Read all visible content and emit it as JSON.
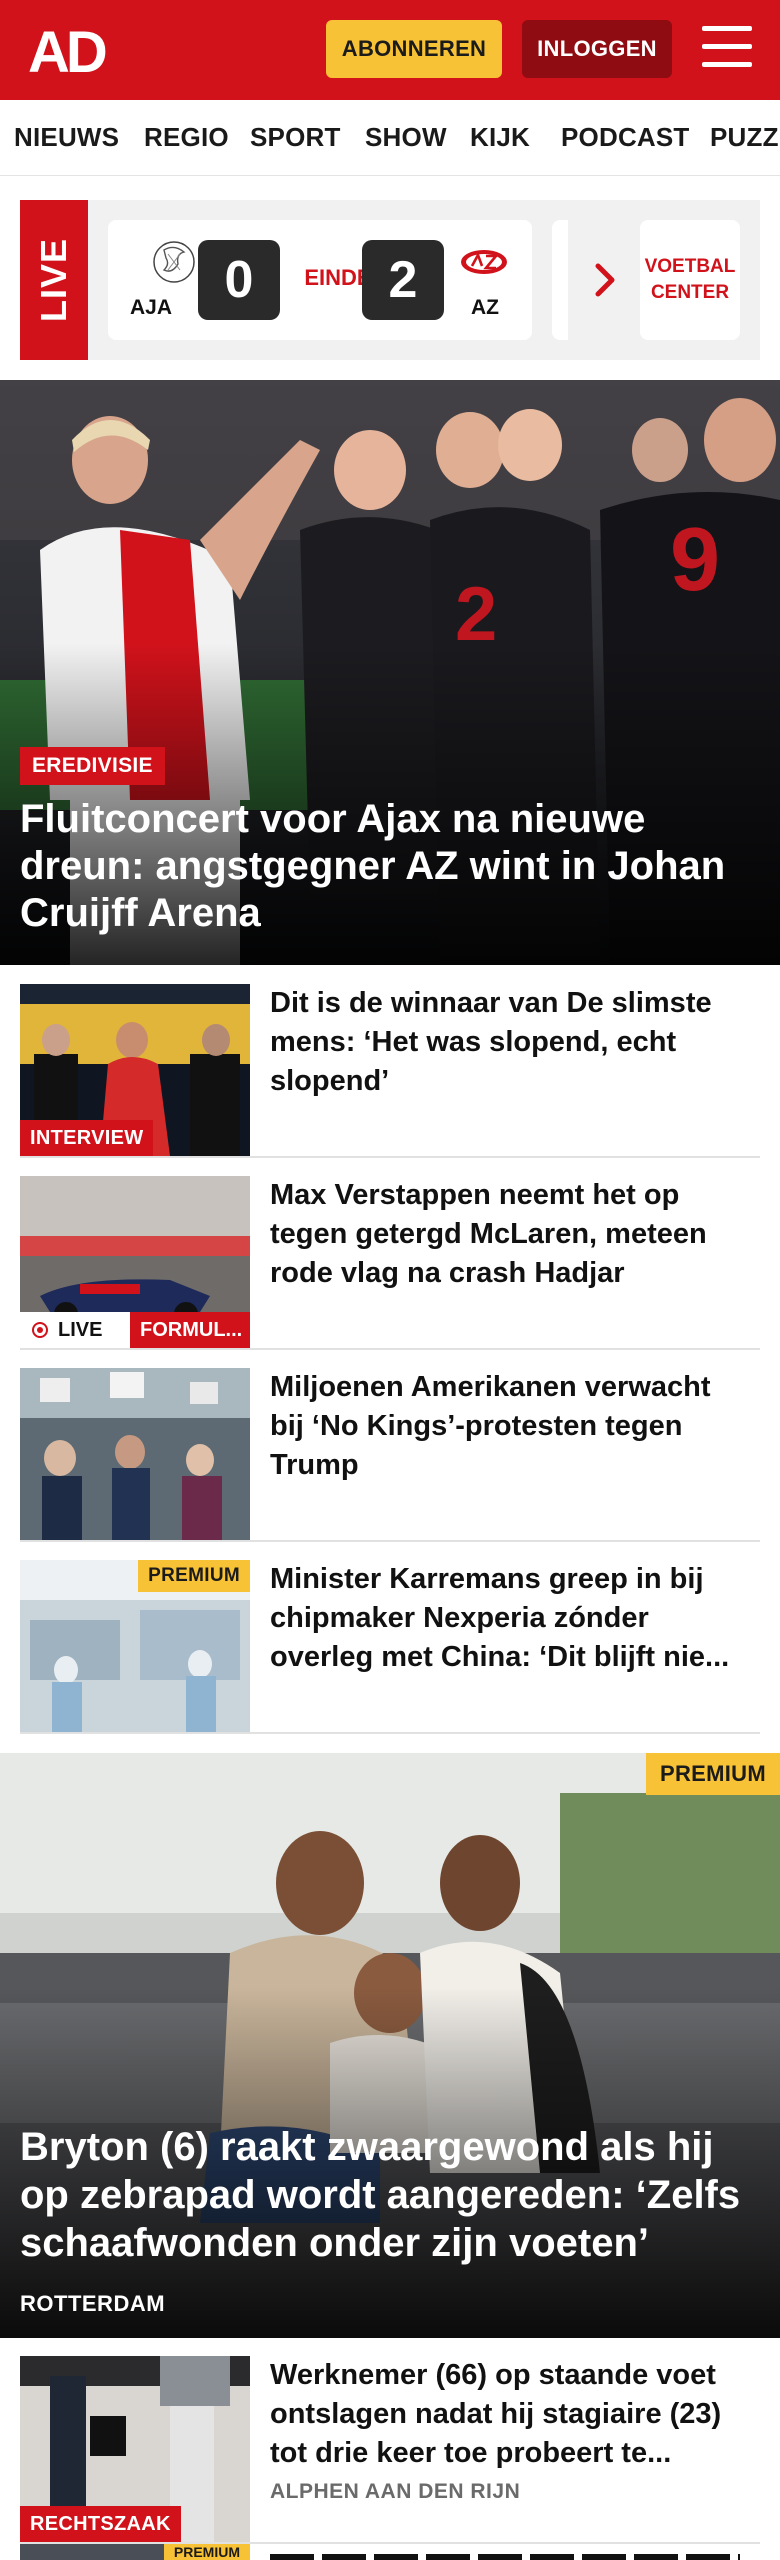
{
  "header": {
    "logo_text": "AD",
    "subscribe_label": "ABONNEREN",
    "login_label": "INLOGGEN",
    "brand_color": "#d1121b"
  },
  "nav": {
    "items": [
      "NIEUWS",
      "REGIO",
      "SPORT",
      "SHOW",
      "KIJK",
      "PODCAST",
      "PUZZ"
    ]
  },
  "live_scores": {
    "label": "LIVE",
    "match": {
      "home_team": "AJA",
      "home_score": "0",
      "status": "EINDE",
      "away_score": "2",
      "away_team": "AZ"
    },
    "voetbal_center_line1": "VOETBAL",
    "voetbal_center_line2": "CENTER"
  },
  "hero": {
    "tag": "EREDIVISIE",
    "title": "Fluitconcert voor Ajax na nieuwe dreun: angstgegner AZ wint in Johan Cruijff Arena"
  },
  "articles": [
    {
      "title": "Dit is de winnaar van De slimste mens: ‘Het was slopend, echt slopend’",
      "tag": "INTERVIEW"
    },
    {
      "title": "Max Verstappen neemt het op tegen getergd McLaren, meteen rode vlag na crash Hadjar",
      "live_label": "LIVE",
      "tag": "FORMUL..."
    },
    {
      "title": "Miljoenen Amerikanen verwacht bij ‘No Kings’-protesten tegen Trump"
    },
    {
      "title": "Minister Karremans greep in bij chipmaker Nexperia zónder overleg met China: ‘Dit blijft nie...",
      "premium": "PREMIUM"
    }
  ],
  "feature": {
    "premium": "PREMIUM",
    "title": "Bryton (6) raakt zwaargewond als hij op zebrapad wordt aangereden: ‘Zelfs schaafwonden onder zijn voeten’",
    "location": "ROTTERDAM"
  },
  "article_after": {
    "title": "Werknemer (66) op staande voet ontslagen nadat hij stagiaire (23) tot drie keer toe probeert te...",
    "location": "ALPHEN AAN DEN RIJN",
    "tag": "RECHTSZAAK"
  },
  "peek": {
    "premium": "PREMIUM"
  }
}
